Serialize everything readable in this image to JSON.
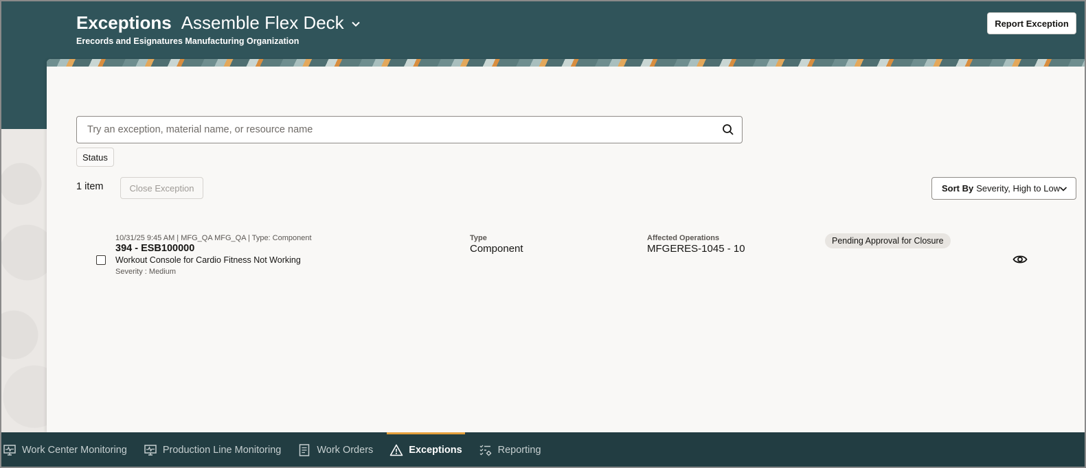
{
  "header": {
    "title": "Exceptions",
    "context": "Assemble Flex Deck",
    "subtitle": "Erecords and Esignatures Manufacturing Organization",
    "report_button": "Report Exception"
  },
  "search": {
    "placeholder": "Try an exception, material name, or resource name"
  },
  "filters": {
    "status_chip": "Status"
  },
  "toolbar": {
    "item_count": "1 item",
    "close_button": "Close Exception",
    "sort_prefix": "Sort By",
    "sort_value": "Severity, High to Low"
  },
  "exceptions": [
    {
      "meta": "10/31/25 9:45 AM | MFG_QA MFG_QA | Type: Component",
      "title": "394 - ESB100000",
      "description": "Workout Console for Cardio Fitness Not Working",
      "severity": "Severity : Medium",
      "type_label": "Type",
      "type_value": "Component",
      "ops_label": "Affected Operations",
      "ops_value": "MFGERES-1045 - 10",
      "status": "Pending Approval for Closure"
    }
  ],
  "nav": [
    {
      "label": "Work Center Monitoring",
      "icon": "monitor-pulse-icon"
    },
    {
      "label": "Production Line Monitoring",
      "icon": "monitor-pulse-icon"
    },
    {
      "label": "Work Orders",
      "icon": "document-icon"
    },
    {
      "label": "Exceptions",
      "icon": "warning-triangle-icon",
      "active": true
    },
    {
      "label": "Reporting",
      "icon": "checklist-gear-icon"
    }
  ],
  "colors": {
    "header_bg": "#30545a",
    "nav_bg": "#223d42",
    "active_tab_accent": "#e4a03c"
  }
}
